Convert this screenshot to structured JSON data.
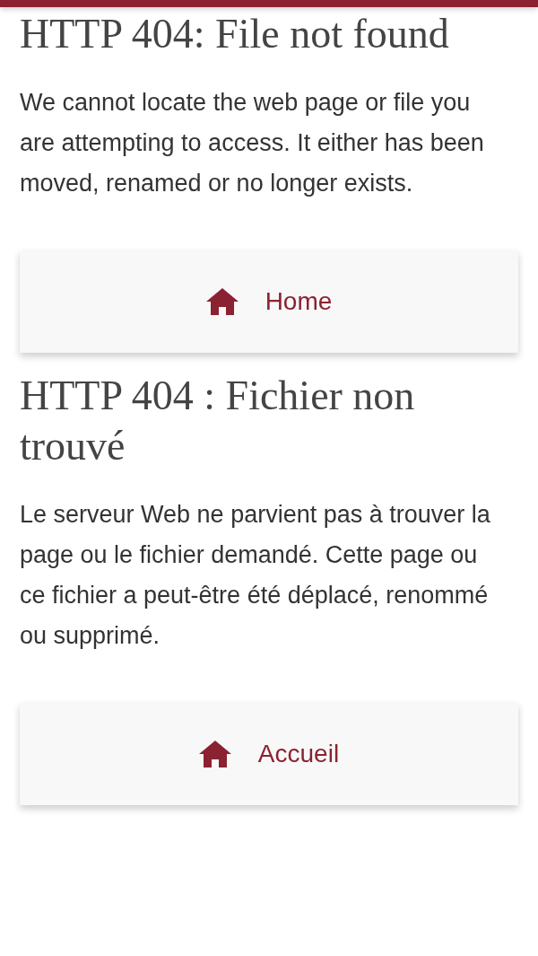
{
  "sections": [
    {
      "heading": "HTTP 404: File not found",
      "body": "We cannot locate the web page or file you are attempting to access. It either has been moved, renamed or no longer exists.",
      "button": "Home"
    },
    {
      "heading": "HTTP 404 : Fichier non trouvé",
      "body": "Le serveur Web ne parvient pas à trouver la page ou le fichier demandé. Cette page ou ce fichier a peut-être été déplacé, renommé ou supprimé.",
      "button": "Accueil"
    }
  ]
}
